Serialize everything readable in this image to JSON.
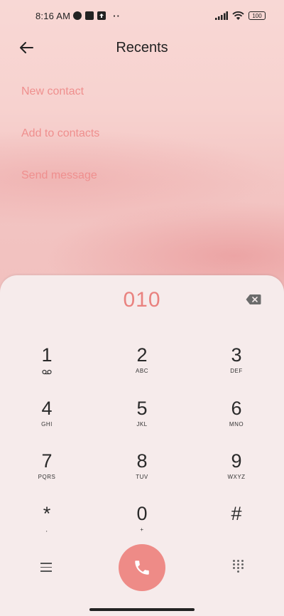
{
  "status_bar": {
    "time": "8:16 AM",
    "battery": "100"
  },
  "header": {
    "title": "Recents"
  },
  "menu": {
    "items": [
      "New contact",
      "Add to contacts",
      "Send message"
    ]
  },
  "dialer": {
    "number": "010",
    "keys": [
      {
        "digit": "1",
        "letters": ""
      },
      {
        "digit": "2",
        "letters": "ABC"
      },
      {
        "digit": "3",
        "letters": "DEF"
      },
      {
        "digit": "4",
        "letters": "GHI"
      },
      {
        "digit": "5",
        "letters": "JKL"
      },
      {
        "digit": "6",
        "letters": "MNO"
      },
      {
        "digit": "7",
        "letters": "PQRS"
      },
      {
        "digit": "8",
        "letters": "TUV"
      },
      {
        "digit": "9",
        "letters": "WXYZ"
      },
      {
        "digit": "*",
        "letters": ","
      },
      {
        "digit": "0",
        "letters": "+"
      },
      {
        "digit": "#",
        "letters": ""
      }
    ]
  },
  "colors": {
    "accent": "#ee8b87",
    "menu_text": "#ef8f8e",
    "number_text": "#e9827f"
  },
  "icons": {
    "back": "arrow-left-icon",
    "backspace": "backspace-icon",
    "voicemail": "voicemail-icon",
    "menu": "hamburger-icon",
    "call": "phone-icon",
    "dialpad": "dialpad-icon"
  }
}
